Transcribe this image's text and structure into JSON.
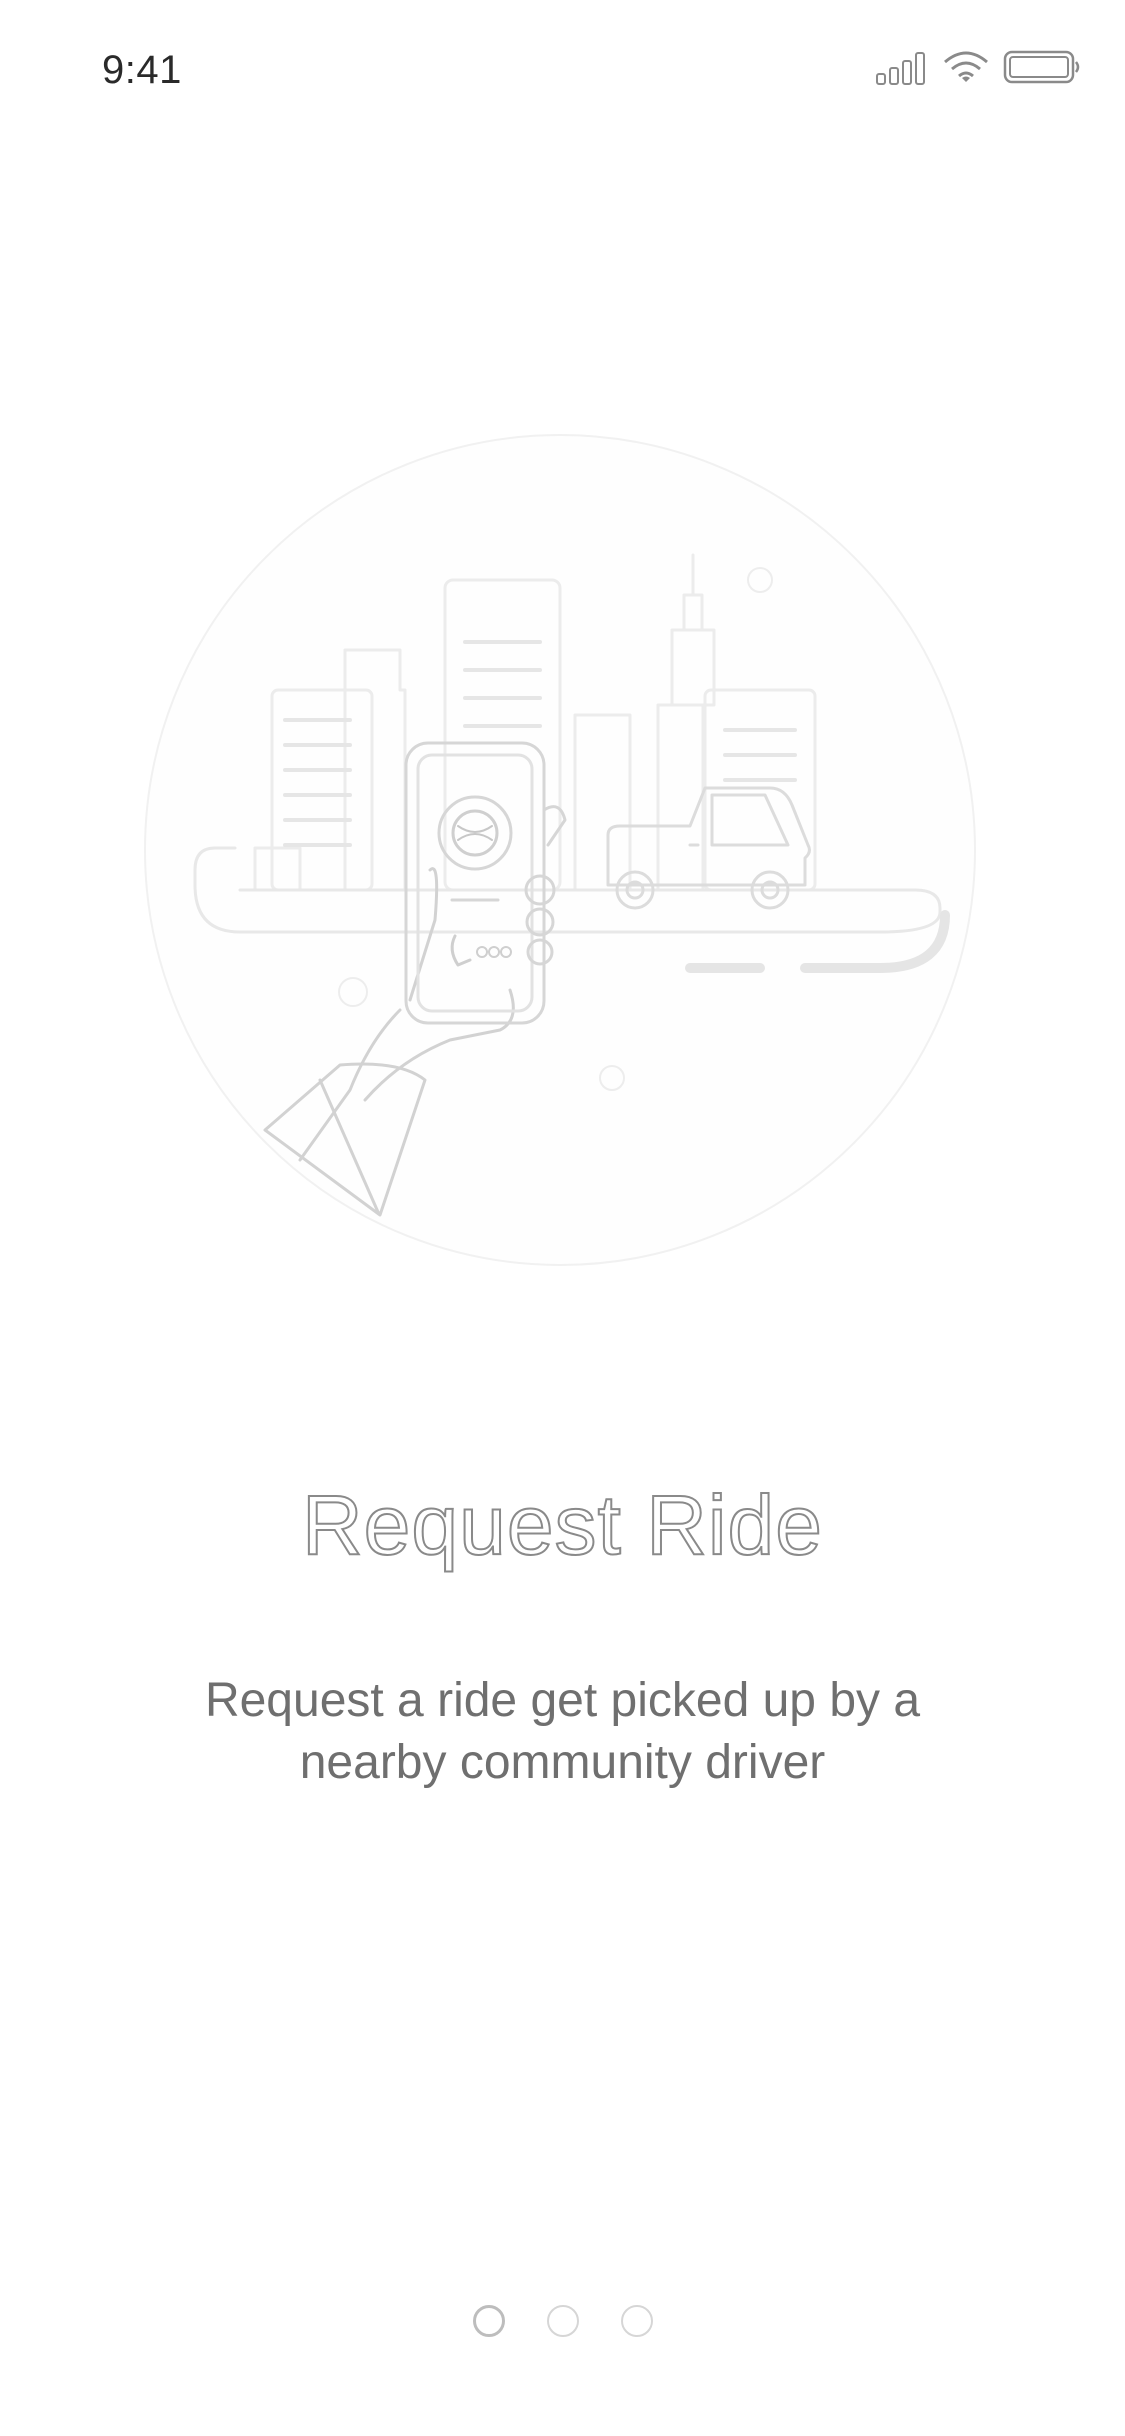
{
  "status_bar": {
    "time": "9:41",
    "icons": [
      "cellular-signal-icon",
      "wifi-icon",
      "battery-icon"
    ]
  },
  "illustration": {
    "name": "request-ride-illustration"
  },
  "onboarding": {
    "title": "Request Ride",
    "description": "Request a ride get picked up by a nearby community driver"
  },
  "pagination": {
    "total_pages": 3,
    "current_page": 1
  }
}
